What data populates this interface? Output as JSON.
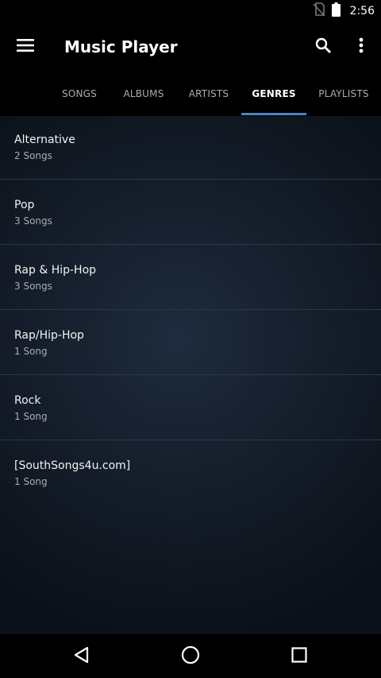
{
  "status_bar": {
    "time": "2:56",
    "icons": [
      "no-sim-icon",
      "battery-icon"
    ]
  },
  "app_bar": {
    "title": "Music Player",
    "icons": [
      "menu-icon",
      "search-icon",
      "more-vert-icon"
    ]
  },
  "tabs": [
    {
      "label": "SONGS",
      "active": false
    },
    {
      "label": "ALBUMS",
      "active": false
    },
    {
      "label": "ARTISTS",
      "active": false
    },
    {
      "label": "GENRES",
      "active": true
    },
    {
      "label": "PLAYLISTS",
      "active": false
    }
  ],
  "genres": [
    {
      "name": "Alternative",
      "count": "2 Songs"
    },
    {
      "name": "Pop",
      "count": "3 Songs"
    },
    {
      "name": "Rap & Hip-Hop",
      "count": "3 Songs"
    },
    {
      "name": "Rap/Hip-Hop",
      "count": "1 Song"
    },
    {
      "name": "Rock",
      "count": "1 Song"
    },
    {
      "name": "[SouthSongs4u.com]",
      "count": "1 Song"
    }
  ],
  "nav_bar": {
    "icons": [
      "back-icon",
      "home-icon",
      "recents-icon"
    ]
  },
  "colors": {
    "accent": "#4a83c4",
    "background": "#000000",
    "list_background": "#141d2a",
    "text_primary": "#f2f2f2",
    "text_secondary": "#a9adb3",
    "tab_inactive": "#a8adb4"
  }
}
